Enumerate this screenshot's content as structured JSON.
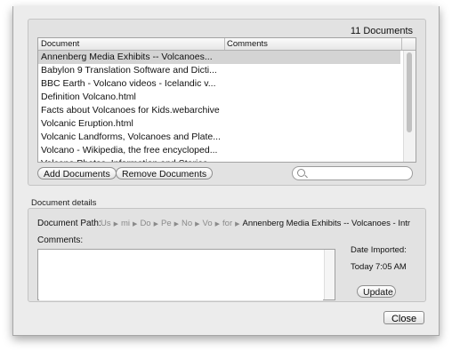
{
  "document_count": "11 Documents",
  "table": {
    "columns": [
      "Document",
      "Comments"
    ],
    "rows": [
      "Annenberg Media Exhibits -- Volcanoes...",
      "Babylon 9 Translation Software and Dicti...",
      "BBC Earth - Volcano videos - Icelandic v...",
      "Definition Volcano.html",
      "Facts about Volcanoes for Kids.webarchive",
      "Volcanic Eruption.html",
      "Volcanic Landforms, Volcanoes and Plate...",
      "Volcano - Wikipedia, the free encycloped...",
      "Volcano Photos, Information and Stories...."
    ],
    "selected_index": 0
  },
  "buttons": {
    "add": "Add Documents",
    "remove": "Remove Documents",
    "update": "Update",
    "close": "Close"
  },
  "search": {
    "placeholder": "",
    "value": ""
  },
  "details": {
    "section_title": "Document details",
    "path_label": "Document Path:",
    "path_parts": [
      "Us",
      "mi",
      "Do",
      "Pe",
      "No",
      "Vo",
      "for"
    ],
    "path_last": "Annenberg Media Exhibits -- Volcanoes - Intr",
    "comments_label": "Comments:",
    "comments_value": "",
    "date_label": "Date Imported:",
    "date_value": "Today 7:05 AM"
  },
  "icons": {
    "search": "search-icon",
    "path_separator": "right-arrow-icon"
  }
}
